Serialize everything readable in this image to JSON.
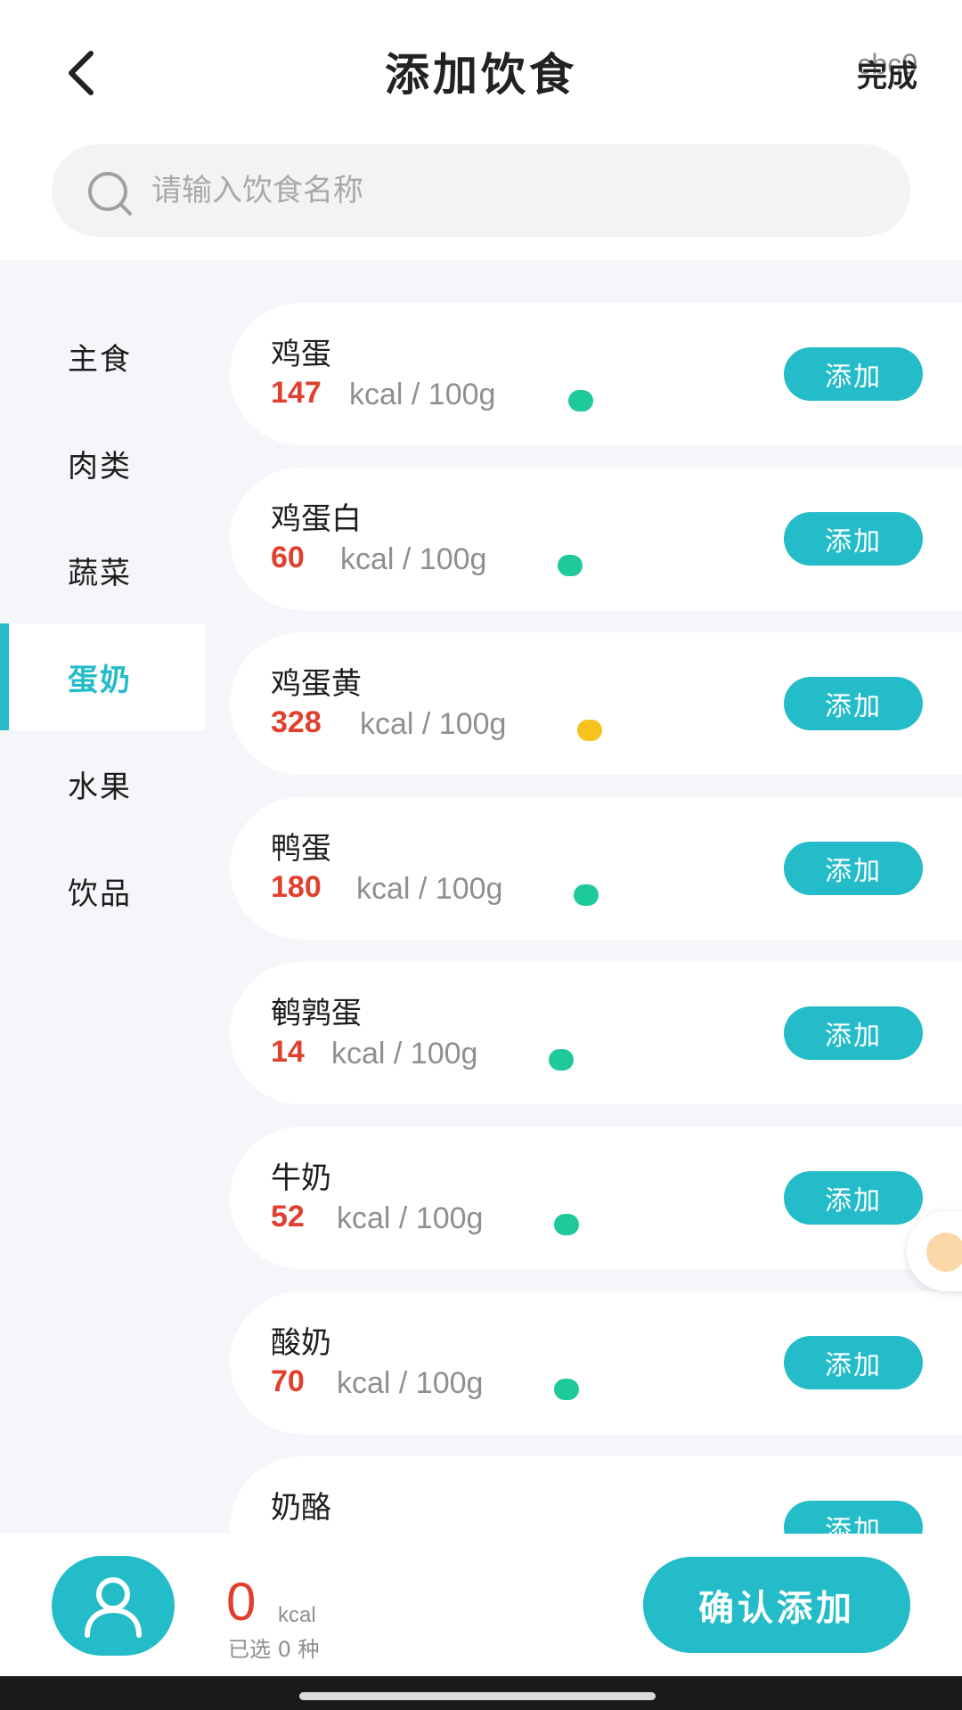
{
  "header": {
    "title": "添加饮食",
    "done_label": "完成",
    "done_ghost": "cbc0"
  },
  "search": {
    "placeholder": "请输入饮食名称"
  },
  "categories": [
    {
      "label": "主食",
      "active": false
    },
    {
      "label": "肉类",
      "active": false
    },
    {
      "label": "蔬菜",
      "active": false
    },
    {
      "label": "蛋奶",
      "active": true
    },
    {
      "label": "水果",
      "active": false
    },
    {
      "label": "饮品",
      "active": false
    }
  ],
  "foods": [
    {
      "name": "鸡蛋",
      "kcal": "147",
      "unit": "kcal / 100g",
      "level": "green",
      "add_label": "添加"
    },
    {
      "name": "鸡蛋白",
      "kcal": "60",
      "unit": "kcal / 100g",
      "level": "green",
      "add_label": "添加"
    },
    {
      "name": "鸡蛋黄",
      "kcal": "328",
      "unit": "kcal / 100g",
      "level": "yellow",
      "add_label": "添加"
    },
    {
      "name": "鸭蛋",
      "kcal": "180",
      "unit": "kcal / 100g",
      "level": "green",
      "add_label": "添加"
    },
    {
      "name": "鹌鹑蛋",
      "kcal": "14",
      "unit": "kcal / 100g",
      "level": "green",
      "add_label": "添加"
    },
    {
      "name": "牛奶",
      "kcal": "52",
      "unit": "kcal / 100g",
      "level": "green",
      "add_label": "添加"
    },
    {
      "name": "酸奶",
      "kcal": "70",
      "unit": "kcal / 100g",
      "level": "green",
      "add_label": "添加"
    },
    {
      "name": "奶酪",
      "kcal": "",
      "unit": "",
      "level": "",
      "add_label": "添加"
    }
  ],
  "level_colors": {
    "green": "#1ec99a",
    "yellow": "#f6c31e"
  },
  "summary": {
    "total_kcal": "0",
    "kcal_unit": "kcal",
    "selected_text": "已选 0 种",
    "confirm_label": "确认添加"
  },
  "icons": {
    "back": "chevron-left-icon",
    "search": "search-icon",
    "avatar": "user-icon"
  },
  "colors": {
    "accent": "#23bcc8",
    "kcal_red": "#e0402d"
  }
}
